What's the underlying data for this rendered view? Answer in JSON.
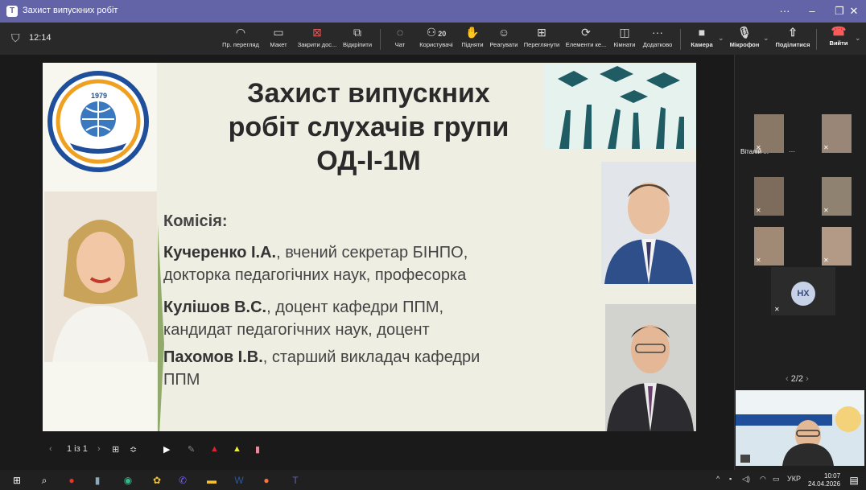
{
  "window": {
    "title": "Захист випускних робіт",
    "more": "···",
    "minimize": "–",
    "restore": "❐",
    "close": "✕"
  },
  "toolbar": {
    "timer": "12:14",
    "items": [
      {
        "label": "Пр. перегляд",
        "icon": "eye-icon",
        "glyph": "◠"
      },
      {
        "label": "Макет",
        "icon": "layout-icon",
        "glyph": "▭"
      },
      {
        "label": "Закрити дос...",
        "icon": "close-share-icon",
        "glyph": "⊠"
      },
      {
        "label": "Відкріпити",
        "icon": "unpin-icon",
        "glyph": "⧉"
      },
      {
        "label": "Чат",
        "icon": "chat-icon",
        "glyph": "◌"
      },
      {
        "label": "Користувачі",
        "icon": "people-icon",
        "glyph": "⚇",
        "count": "20"
      },
      {
        "label": "Підняти",
        "icon": "raise-hand-icon",
        "glyph": "✋"
      },
      {
        "label": "Реагувати",
        "icon": "react-icon",
        "glyph": "☺"
      },
      {
        "label": "Переглянути",
        "icon": "view-icon",
        "glyph": "⊞"
      },
      {
        "label": "Елементи ке...",
        "icon": "apps-icon",
        "glyph": "⟳"
      },
      {
        "label": "Кімнати",
        "icon": "rooms-icon",
        "glyph": "◫"
      },
      {
        "label": "Додатково",
        "icon": "more-icon",
        "glyph": "···"
      },
      {
        "label": "Камера",
        "icon": "camera-icon",
        "glyph": "■"
      },
      {
        "label": "Мікрофон",
        "icon": "microphone-icon",
        "glyph": "🎙"
      },
      {
        "label": "Поділитися",
        "icon": "share-icon",
        "glyph": "⇧"
      }
    ],
    "leave": "Вийти"
  },
  "slide": {
    "title_lines": [
      "Захист випускних",
      "робіт слухачів групи",
      "ОД-І-1М"
    ],
    "commission_label": "Комісія:",
    "members": [
      {
        "name": "Кучеренко І.А.",
        "rest": ", вчений секретар БІНПО,",
        "line2": "докторка педагогічних наук, професорка"
      },
      {
        "name": "Кулішов В.С.",
        "rest": ", доцент кафедри ППМ,",
        "line2": "кандидат педагогічних наук, доцент"
      },
      {
        "name": "Пахомов І.В.",
        "rest": ", старший викладач кафедри",
        "line2": "ППМ"
      }
    ],
    "logo_year": "1979"
  },
  "slide_controls": {
    "page": "1 із 1"
  },
  "participants": {
    "name_tag": "Віталій ...",
    "avatar_initials": "НХ",
    "pager": "2/2"
  },
  "taskbar": {
    "language": "УКР",
    "time": "10:07",
    "date": "24.04.2026"
  }
}
